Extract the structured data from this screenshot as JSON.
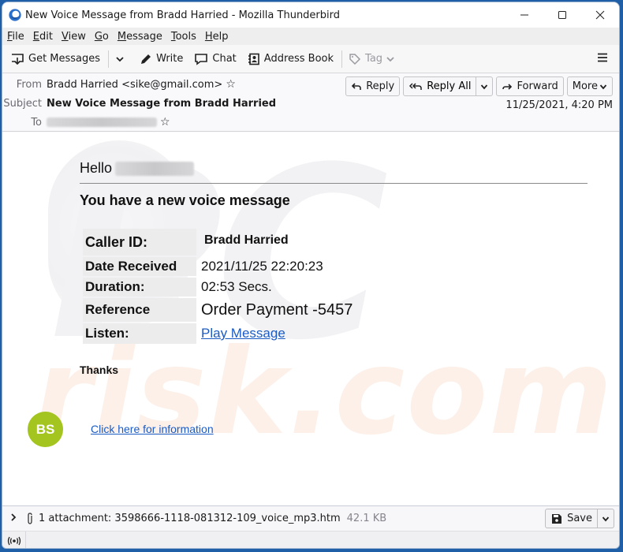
{
  "window": {
    "title": "New Voice Message from Bradd Harried - Mozilla Thunderbird",
    "controls": {
      "minimize": "—",
      "maximize": "☐",
      "close": "✕"
    }
  },
  "menubar": {
    "items": [
      {
        "accel": "F",
        "rest": "ile"
      },
      {
        "accel": "E",
        "rest": "dit"
      },
      {
        "accel": "V",
        "rest": "iew"
      },
      {
        "accel": "G",
        "rest": "o"
      },
      {
        "accel": "M",
        "rest": "essage"
      },
      {
        "accel": "T",
        "rest": "ools"
      },
      {
        "accel": "H",
        "rest": "elp"
      }
    ]
  },
  "toolbar": {
    "get_messages": "Get Messages",
    "write": "Write",
    "chat": "Chat",
    "address_book": "Address Book",
    "tag": "Tag",
    "menu_glyph": "☰",
    "dropdown_glyph": "⌄"
  },
  "header": {
    "from_label": "From",
    "from_value": "Bradd Harried <sike@gmail.com>",
    "subject_label": "Subject",
    "subject_value": "New Voice Message from Bradd Harried",
    "to_label": "To",
    "star_glyph": "☆",
    "date": "11/25/2021, 4:20 PM",
    "actions": {
      "reply": "Reply",
      "reply_all": "Reply All",
      "forward": "Forward",
      "more": "More"
    }
  },
  "message": {
    "greeting": "Hello",
    "headline": "You have a new  voice message",
    "details": [
      {
        "key": "Caller ID:",
        "value": "Bradd Harried"
      },
      {
        "key": "Date Received",
        "value": "2021/11/25 22:20:23"
      },
      {
        "key": "Duration:",
        "value": "02:53 Secs."
      },
      {
        "key": "Reference",
        "value": "Order Payment -5457"
      },
      {
        "key": "Listen:",
        "value": "Play Message"
      }
    ],
    "thanks": "Thanks",
    "avatar_initials": "BS",
    "info_link": "Click here for information",
    "watermark_top": "PC",
    "watermark_bottom": "risk.com"
  },
  "attachment": {
    "label": "1 attachment: 3598666-1118-081312-109_voice_mp3.htm",
    "size": "42.1 KB",
    "save": "Save"
  },
  "colors": {
    "accent_blue": "#1f5fa8",
    "link": "#1a5bc4",
    "avatar_bg": "#a4c520"
  }
}
